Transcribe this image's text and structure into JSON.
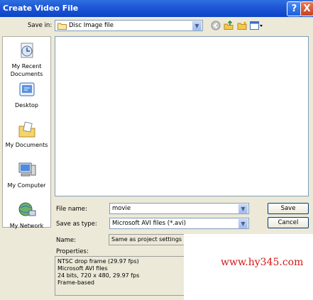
{
  "window": {
    "title": "Create Video File"
  },
  "titlebar_buttons": {
    "help": "?",
    "close": "X"
  },
  "save_in": {
    "label": "Save in:",
    "value": "Disc Image file"
  },
  "places": [
    {
      "name": "my-recent-documents",
      "label_line1": "My Recent",
      "label_line2": "Documents",
      "icon": "recent-documents-icon"
    },
    {
      "name": "desktop",
      "label_line1": "Desktop",
      "label_line2": "",
      "icon": "desktop-icon"
    },
    {
      "name": "my-documents",
      "label_line1": "My Documents",
      "label_line2": "",
      "icon": "documents-folder-icon"
    },
    {
      "name": "my-computer",
      "label_line1": "My Computer",
      "label_line2": "",
      "icon": "computer-icon"
    },
    {
      "name": "my-network",
      "label_line1": "My Network",
      "label_line2": "",
      "icon": "network-icon"
    }
  ],
  "file_name": {
    "label": "File name:",
    "value": "movie"
  },
  "save_as_type": {
    "label": "Save as type:",
    "value": "Microsoft AVI files (*.avi)"
  },
  "name_row": {
    "label": "Name:",
    "value": "Same as project settings"
  },
  "properties": {
    "label": "Properties:",
    "lines": [
      "NTSC drop frame (29.97 fps)",
      "Microsoft AVI files",
      "24 bits, 720 x 480, 29.97 fps",
      "Frame-based"
    ]
  },
  "buttons": {
    "save": "Save",
    "cancel": "Cancel"
  },
  "watermark": "www.hy345.com",
  "colors": {
    "titlebar": "#0b44c6",
    "dialog_bg": "#ece9d8",
    "watermark": "#d21818"
  }
}
